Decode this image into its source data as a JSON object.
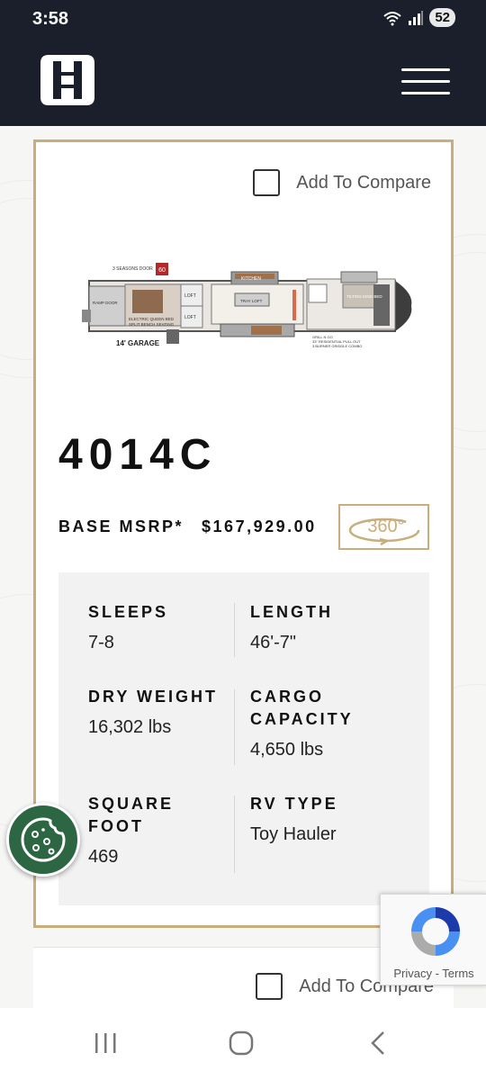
{
  "status_bar": {
    "time": "3:58",
    "battery": "52",
    "network": "5"
  },
  "header": {
    "logo_icon": "brand-logo-icon",
    "menu_icon": "hamburger-menu-icon"
  },
  "card": {
    "compare_label": "Add To Compare",
    "model": "4014C",
    "msrp_label": "BASE MSRP*",
    "msrp_value": "$167,929.00",
    "tour_label": "360°",
    "floorplan": {
      "labels": [
        "3 SEASONS DOOR",
        "60",
        "RAMP DOOR",
        "ELECTRIC QUEEN BED",
        "SPLIT BENCH SEATING",
        "LOFT",
        "LOFT",
        "KITCHEN",
        "TRAY LOFT",
        "TILTING KING BED",
        "14' GARAGE",
        "GRILL N GO",
        "33\" RESIDENTIAL PULL OUT",
        "3 BURNER GRIDDLE COMBO"
      ]
    },
    "specs": [
      {
        "label": "SLEEPS",
        "value": "7-8"
      },
      {
        "label": "LENGTH",
        "value": "46'-7\""
      },
      {
        "label": "DRY WEIGHT",
        "value": "16,302 lbs"
      },
      {
        "label": "CARGO CAPACITY",
        "value": "4,650 lbs"
      },
      {
        "label": "SQUARE FOOT",
        "value": "469"
      },
      {
        "label": "RV TYPE",
        "value": "Toy Hauler"
      }
    ]
  },
  "card2": {
    "compare_label": "Add To Compare"
  },
  "recaptcha": {
    "privacy": "Privacy",
    "separator": " - ",
    "terms": "Terms"
  },
  "colors": {
    "header_bg": "#1b1f2b",
    "accent_gold": "#c9ad7a",
    "cookie_green": "#2d6642"
  }
}
